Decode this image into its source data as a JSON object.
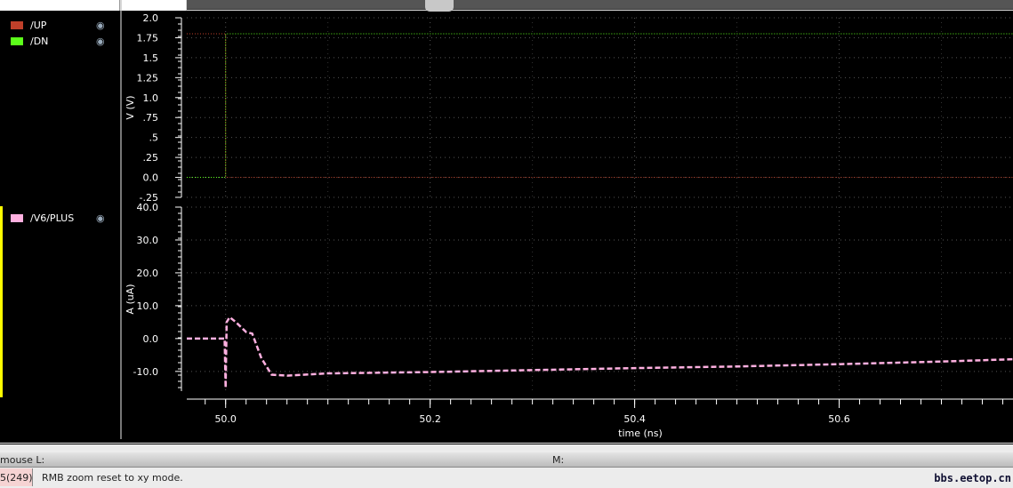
{
  "legend": {
    "upper": [
      {
        "name": "/UP",
        "color": "#c0402a"
      },
      {
        "name": "/DN",
        "color": "#5cff1a"
      }
    ],
    "lower": [
      {
        "name": "/V6/PLUS",
        "color": "#ffb0e0"
      }
    ],
    "visibility_icon": "eye-icon"
  },
  "status": {
    "mouse_l": "mouse L:",
    "mouse_m": "M:",
    "count": "5(249)",
    "message": "RMB zoom reset to xy mode.",
    "watermark": "bbs.eetop.cn"
  },
  "chart_data": [
    {
      "type": "line",
      "ylabel": "V (V)",
      "ylim": [
        -0.25,
        2.0
      ],
      "yticks": [
        "2.0",
        "1.75",
        "1.5",
        "1.25",
        "1.0",
        ".75",
        ".5",
        ".25",
        "0.0",
        "-.25"
      ],
      "grid": true,
      "series": [
        {
          "name": "/UP",
          "color": "#c0402a",
          "x": [
            49.962,
            50.0,
            50.0,
            50.77
          ],
          "y": [
            1.8,
            1.8,
            0,
            0
          ]
        },
        {
          "name": "/DN",
          "color": "#5cff1a",
          "x": [
            49.962,
            50.0,
            50.0,
            50.77
          ],
          "y": [
            0,
            0,
            1.8,
            1.8
          ]
        }
      ]
    },
    {
      "type": "line",
      "ylabel": "A (uA)",
      "ylim": [
        -16,
        40
      ],
      "yticks": [
        "40.0",
        "30.0",
        "20.0",
        "10.0",
        "0.0",
        "-10.0"
      ],
      "grid": true,
      "series": [
        {
          "name": "/V6/PLUS",
          "color": "#ffb0e0",
          "x": [
            49.962,
            49.999,
            50.0,
            50.001,
            50.004,
            50.01,
            50.02,
            50.026,
            50.035,
            50.045,
            50.06,
            50.1,
            50.2,
            50.3,
            50.4,
            50.5,
            50.6,
            50.7,
            50.77
          ],
          "y": [
            0,
            0,
            -15,
            5,
            6.5,
            5,
            2,
            1.5,
            -6,
            -11,
            -11.3,
            -10.6,
            -10.2,
            -9.6,
            -9,
            -8.5,
            -7.8,
            -7.0,
            -6.3
          ]
        }
      ]
    }
  ],
  "xaxis": {
    "label": "time (ns)",
    "ticks": [
      "50.0",
      "50.2",
      "50.4",
      "50.6"
    ],
    "tick_values": [
      50.0,
      50.2,
      50.4,
      50.6
    ],
    "xlim": [
      49.962,
      50.77
    ]
  }
}
